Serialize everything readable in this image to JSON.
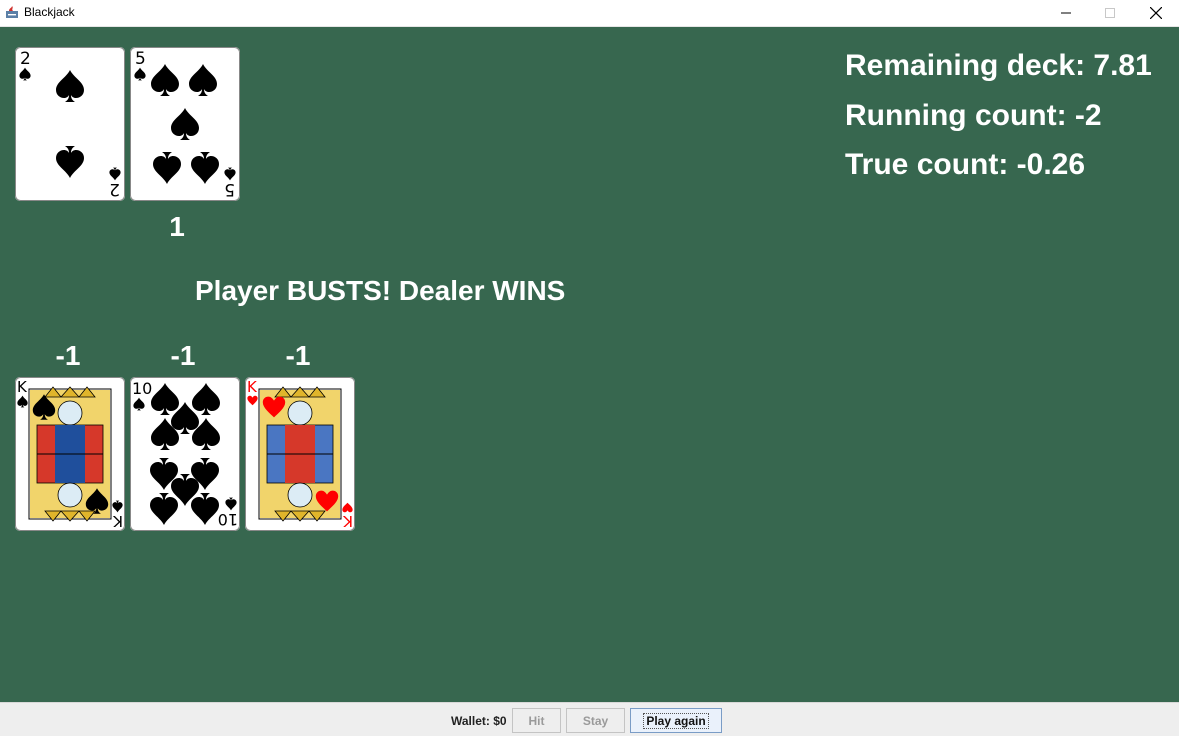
{
  "window": {
    "title": "Blackjack"
  },
  "dealer": {
    "count_label": "1",
    "cards": [
      {
        "rank": "2",
        "suit": "spades",
        "color": "#000000"
      },
      {
        "rank": "5",
        "suit": "spades",
        "color": "#000000"
      }
    ]
  },
  "message": "Player BUSTS! Dealer WINS",
  "player": {
    "cards": [
      {
        "rank": "K",
        "suit": "spades",
        "color": "#000000",
        "count_label": "-1"
      },
      {
        "rank": "10",
        "suit": "spades",
        "color": "#000000",
        "count_label": "-1"
      },
      {
        "rank": "K",
        "suit": "hearts",
        "color": "#ff0000",
        "count_label": "-1"
      }
    ]
  },
  "stats": {
    "remaining_deck": "Remaining deck: 7.81",
    "running_count": "Running count: -2",
    "true_count": "True count: -0.26"
  },
  "controls": {
    "wallet": "Wallet: $0",
    "hit_label": "Hit",
    "stay_label": "Stay",
    "play_again_label": "Play again"
  },
  "colors": {
    "table_green": "#37674f",
    "spade_black": "#000000",
    "heart_red": "#ff0000"
  }
}
